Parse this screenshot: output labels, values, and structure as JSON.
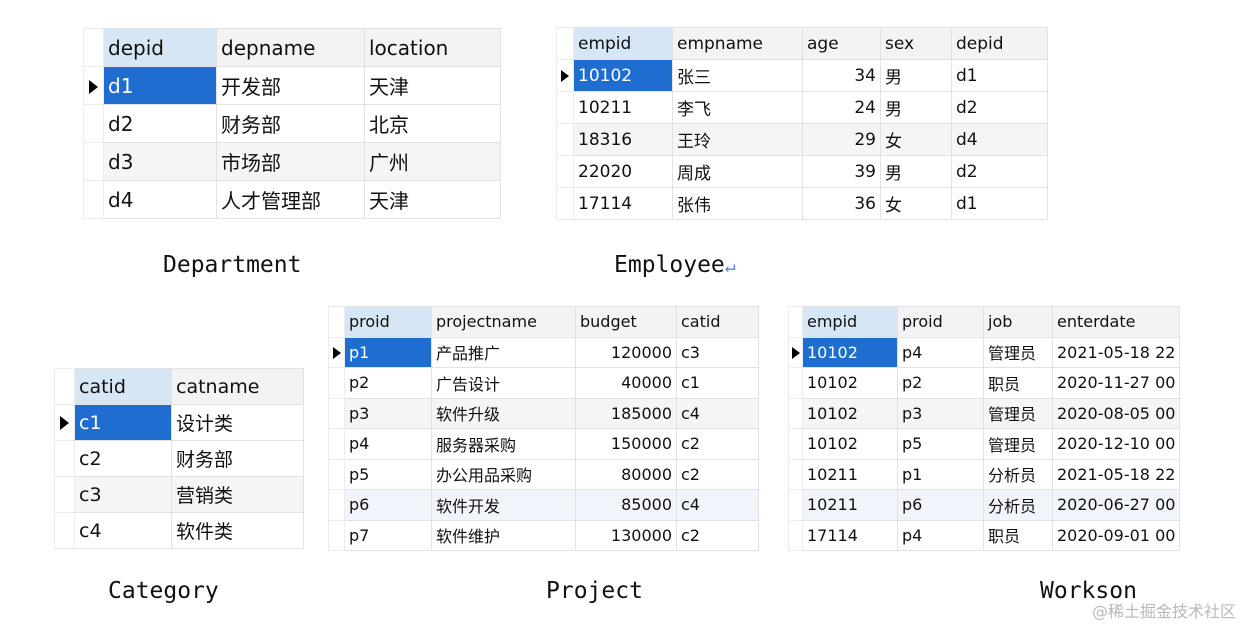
{
  "department": {
    "caption": "Department",
    "headers": [
      "depid",
      "depname",
      "location"
    ],
    "rows": [
      [
        "d1",
        "开发部",
        "天津"
      ],
      [
        "d2",
        "财务部",
        "北京"
      ],
      [
        "d3",
        "市场部",
        "广州"
      ],
      [
        "d4",
        "人才管理部",
        "天津"
      ]
    ]
  },
  "employee": {
    "caption": "Employee",
    "headers": [
      "empid",
      "empname",
      "age",
      "sex",
      "depid"
    ],
    "rows": [
      [
        "10102",
        "张三",
        "34",
        "男",
        "d1"
      ],
      [
        "10211",
        "李飞",
        "24",
        "男",
        "d2"
      ],
      [
        "18316",
        "王玲",
        "29",
        "女",
        "d4"
      ],
      [
        "22020",
        "周成",
        "39",
        "男",
        "d2"
      ],
      [
        "17114",
        "张伟",
        "36",
        "女",
        "d1"
      ]
    ]
  },
  "category": {
    "caption": "Category",
    "headers": [
      "catid",
      "catname"
    ],
    "rows": [
      [
        "c1",
        "设计类"
      ],
      [
        "c2",
        "财务部"
      ],
      [
        "c3",
        "营销类"
      ],
      [
        "c4",
        "软件类"
      ]
    ]
  },
  "project": {
    "caption": "Project",
    "headers": [
      "proid",
      "projectname",
      "budget",
      "catid"
    ],
    "rows": [
      [
        "p1",
        "产品推广",
        "120000",
        "c3"
      ],
      [
        "p2",
        "广告设计",
        "40000",
        "c1"
      ],
      [
        "p3",
        "软件升级",
        "185000",
        "c4"
      ],
      [
        "p4",
        "服务器采购",
        "150000",
        "c2"
      ],
      [
        "p5",
        "办公用品采购",
        "80000",
        "c2"
      ],
      [
        "p6",
        "软件开发",
        "85000",
        "c4"
      ],
      [
        "p7",
        "软件维护",
        "130000",
        "c2"
      ]
    ]
  },
  "workson": {
    "caption": "Workson",
    "headers": [
      "empid",
      "proid",
      "job",
      "enterdate"
    ],
    "rows": [
      [
        "10102",
        "p4",
        "管理员",
        "2021-05-18 22"
      ],
      [
        "10102",
        "p2",
        "职员",
        "2020-11-27 00"
      ],
      [
        "10102",
        "p3",
        "管理员",
        "2020-08-05 00"
      ],
      [
        "10102",
        "p5",
        "管理员",
        "2020-12-10 00"
      ],
      [
        "10211",
        "p1",
        "分析员",
        "2021-05-18 22"
      ],
      [
        "10211",
        "p6",
        "分析员",
        "2020-06-27 00"
      ],
      [
        "17114",
        "p4",
        "职员",
        "2020-09-01 00"
      ]
    ]
  },
  "watermark": "@稀土掘金技术社区",
  "colors": {
    "selection": "#1f6dd0",
    "sorted_header": "#d6e6f5"
  }
}
